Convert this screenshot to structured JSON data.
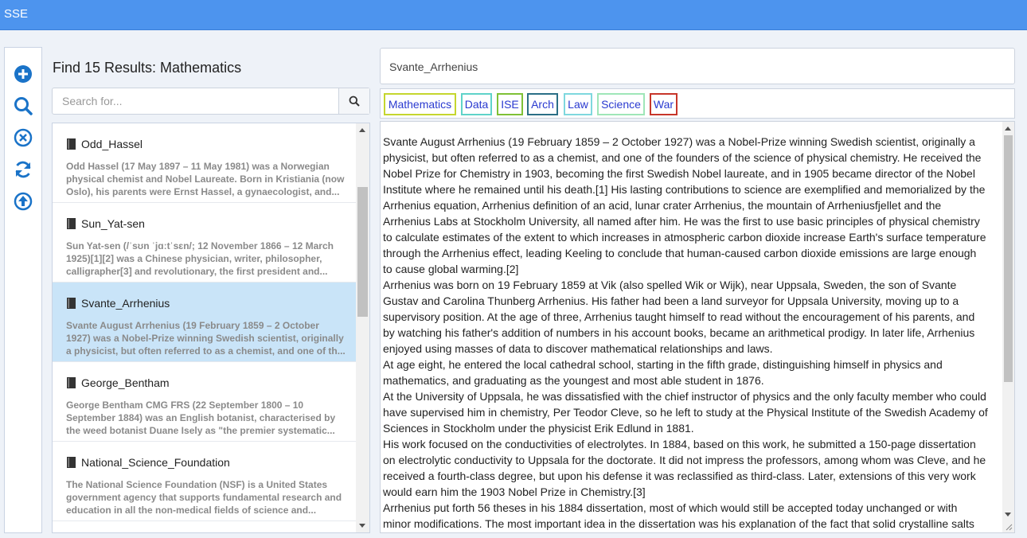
{
  "app": {
    "title": "SSE"
  },
  "toolbar": {
    "tools": [
      {
        "name": "add-icon"
      },
      {
        "name": "search-icon"
      },
      {
        "name": "close-circle-icon"
      },
      {
        "name": "refresh-icon"
      },
      {
        "name": "upload-icon"
      }
    ],
    "accent": "#1a73c8"
  },
  "results": {
    "header": "Find 15 Results: Mathematics",
    "search_placeholder": "Search for...",
    "items": [
      {
        "title": "Odd_Hassel",
        "snippet": [
          "Odd Hassel (17 May 1897 – 11 May 1981) was a Norwegian",
          "physical chemist and Nobel Laureate. Born in Kristiania (now",
          "Oslo), his parents were Ernst Hassel, a gynaecologist, and..."
        ]
      },
      {
        "title": "Sun_Yat-sen",
        "snippet": [
          "Sun Yat-sen (/ˈsʊn ˈjɑːtˈsɛn/; 12 November 1866 – 12 March",
          "1925)[1][2] was a Chinese physician, writer, philosopher,",
          "calligrapher[3] and revolutionary, the first president and..."
        ]
      },
      {
        "title": "Svante_Arrhenius",
        "snippet": [
          "Svante August Arrhenius (19 February 1859 – 2 October",
          "1927) was a Nobel-Prize winning Swedish scientist, originally",
          "a physicist, but often referred to as a chemist, and one of th..."
        ],
        "selected": true
      },
      {
        "title": "George_Bentham",
        "snippet": [
          "George Bentham CMG FRS (22 September 1800 – 10",
          "September 1884) was an English botanist, characterised by",
          "the weed botanist Duane Isely as \"the premier systematic..."
        ]
      },
      {
        "title": "National_Science_Foundation",
        "snippet": [
          "The National Science Foundation (NSF) is a United States",
          "government agency that supports fundamental research and",
          "education in all the non-medical fields of science and..."
        ]
      }
    ]
  },
  "document": {
    "title": "Svante_Arrhenius",
    "tags": [
      {
        "label": "Mathematics",
        "color": "#c5d62e"
      },
      {
        "label": "Data",
        "color": "#5fd3c9"
      },
      {
        "label": "ISE",
        "color": "#7fc136"
      },
      {
        "label": "Arch",
        "color": "#2b6f86"
      },
      {
        "label": "Law",
        "color": "#7fd8de"
      },
      {
        "label": "Science",
        "color": "#9fe6b8"
      },
      {
        "label": "War",
        "color": "#c7362a"
      }
    ],
    "lines": [
      "Svante August Arrhenius (19 February 1859 – 2 October 1927) was a Nobel-Prize winning Swedish scientist, originally a",
      "physicist, but often referred to as a chemist, and one of the founders of the science of physical chemistry. He received the",
      "Nobel Prize for Chemistry in 1903, becoming the first Swedish Nobel laureate, and in 1905 became director of the Nobel",
      "Institute where he remained until his death.[1] His lasting contributions to science are exemplified and memorialized by the",
      "Arrhenius equation, Arrhenius definition of an acid, lunar crater Arrhenius, the mountain of Arrheniusfjellet and the",
      "Arrhenius Labs at Stockholm University, all named after him. He was the first to use basic principles of physical chemistry",
      "to calculate estimates of the extent to which increases in atmospheric carbon dioxide increase Earth's surface temperature",
      "through the Arrhenius effect, leading Keeling to conclude that human-caused carbon dioxide emissions are large enough",
      "to cause global warming.[2]",
      "Arrhenius was born on 19 February 1859 at Vik (also spelled Wik or Wijk), near Uppsala, Sweden, the son of Svante",
      "Gustav and Carolina Thunberg Arrhenius. His father had been a land surveyor for Uppsala University, moving up to a",
      "supervisory position. At the age of three, Arrhenius taught himself to read without the encouragement of his parents, and",
      "by watching his father's addition of numbers in his account books, became an arithmetical prodigy. In later life, Arrhenius",
      "enjoyed using masses of data to discover mathematical relationships and laws.",
      "At age eight, he entered the local cathedral school, starting in the fifth grade, distinguishing himself in physics and",
      "mathematics, and graduating as the youngest and most able student in 1876.",
      "At the University of Uppsala, he was dissatisfied with the chief instructor of physics and the only faculty member who could",
      "have supervised him in chemistry, Per Teodor Cleve, so he left to study at the Physical Institute of the Swedish Academy of",
      "Sciences in Stockholm under the physicist Erik Edlund in 1881.",
      "His work focused on the conductivities of electrolytes. In 1884, based on this work, he submitted a 150-page dissertation",
      "on electrolytic conductivity to Uppsala for the doctorate. It did not impress the professors, among whom was Cleve, and he",
      "received a fourth-class degree, but upon his defense it was reclassified as third-class. Later, extensions of this very work",
      "would earn him the 1903 Nobel Prize in Chemistry.[3]",
      "Arrhenius put forth 56 theses in his 1884 dissertation, most of which would still be accepted today unchanged or with",
      "minor modifications. The most important idea in the dissertation was his explanation of the fact that solid crystalline salts"
    ]
  }
}
